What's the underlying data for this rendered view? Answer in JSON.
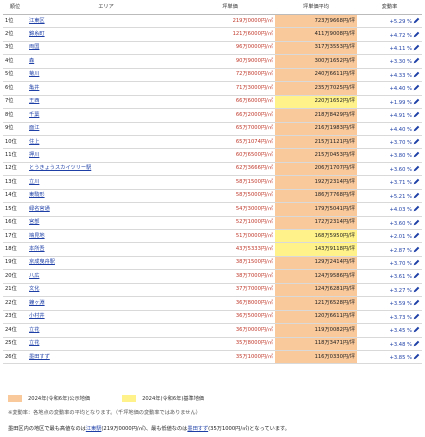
{
  "headers": {
    "rank": "順位",
    "area": "エリア",
    "land": "坪単価",
    "tsubo": "坪単価平均",
    "rate": "変動率"
  },
  "rows": [
    {
      "rank": "1位",
      "area": "江東区",
      "land": "219万0000円/㎡",
      "tsubo": "723万9668円/坪",
      "rate": "+5.29 %"
    },
    {
      "rank": "2位",
      "area": "錦糸町",
      "land": "121万6000円/㎡",
      "tsubo": "411万9008円/坪",
      "rate": "+4.72 %"
    },
    {
      "rank": "3位",
      "area": "両国",
      "land": "96万0000円/㎡",
      "tsubo": "317万3553円/坪",
      "rate": "+4.11 %"
    },
    {
      "rank": "4位",
      "area": "森",
      "land": "90万9000円/㎡",
      "tsubo": "300万1652円/坪",
      "rate": "+3.30 %"
    },
    {
      "rank": "5位",
      "area": "菊川",
      "land": "72万8000円/㎡",
      "tsubo": "240万6611円/坪",
      "rate": "+4.33 %"
    },
    {
      "rank": "6位",
      "area": "亀井",
      "land": "71万3000円/㎡",
      "tsubo": "235万7025円/坪",
      "rate": "+4.40 %"
    },
    {
      "rank": "7位",
      "area": "王西",
      "land": "66万6000円/㎡",
      "tsubo": "220万1652円/坪",
      "rate": "+1.99 %",
      "highlight": true
    },
    {
      "rank": "8位",
      "area": "千葉",
      "land": "66万2000円/㎡",
      "tsubo": "218万8429円/坪",
      "rate": "+4.91 %"
    },
    {
      "rank": "9位",
      "area": "面江",
      "land": "65万7000円/㎡",
      "tsubo": "216万1983円/坪",
      "rate": "+4.40 %"
    },
    {
      "rank": "10位",
      "area": "住上",
      "land": "65万1074円/㎡",
      "tsubo": "215万1121円/坪",
      "rate": "+3.70 %"
    },
    {
      "rank": "11位",
      "area": "押川",
      "land": "60万6500円/㎡",
      "tsubo": "215万0453円/坪",
      "rate": "+3.80 %"
    },
    {
      "rank": "12位",
      "area": "とうきょうスカイツリー駅",
      "land": "62万3666円/㎡",
      "tsubo": "206万1707円/坪",
      "rate": "+3.60 %"
    },
    {
      "rank": "13位",
      "area": "立川",
      "land": "58万1500円/㎡",
      "tsubo": "192万2314円/坪",
      "rate": "+3.71 %"
    },
    {
      "rank": "14位",
      "area": "東駒形",
      "land": "58万5000円/㎡",
      "tsubo": "186万7768円/坪",
      "rate": "+5.21 %"
    },
    {
      "rank": "15位",
      "area": "緑名宮通",
      "land": "54万3000円/㎡",
      "tsubo": "179万5041円/坪",
      "rate": "+4.03 %"
    },
    {
      "rank": "16位",
      "area": "宮部",
      "land": "52万1000円/㎡",
      "tsubo": "172万2314円/坪",
      "rate": "+3.60 %"
    },
    {
      "rank": "17位",
      "area": "鳩見地",
      "land": "51万0000円/㎡",
      "tsubo": "168万5950円/坪",
      "rate": "+2.01 %",
      "highlight": true
    },
    {
      "rank": "18位",
      "area": "本所吾",
      "land": "43万5333円/㎡",
      "tsubo": "143万9118円/坪",
      "rate": "+2.87 %",
      "highlight": true
    },
    {
      "rank": "19位",
      "area": "京成曳舟駅",
      "land": "38万1500円/㎡",
      "tsubo": "129万2414円/坪",
      "rate": "+3.70 %"
    },
    {
      "rank": "20位",
      "area": "八広",
      "land": "38万7000円/㎡",
      "tsubo": "124万9586円/坪",
      "rate": "+3.61 %"
    },
    {
      "rank": "21位",
      "area": "文化",
      "land": "37万7000円/㎡",
      "tsubo": "124万6281円/坪",
      "rate": "+3.27 %"
    },
    {
      "rank": "22位",
      "area": "鐘ヶ淵",
      "land": "36万8000円/㎡",
      "tsubo": "121万6528円/坪",
      "rate": "+3.59 %"
    },
    {
      "rank": "23位",
      "area": "小村井",
      "land": "36万5000円/㎡",
      "tsubo": "120万6611円/坪",
      "rate": "+3.73 %"
    },
    {
      "rank": "24位",
      "area": "立花",
      "land": "36万0000円/㎡",
      "tsubo": "119万0082円/坪",
      "rate": "+3.45 %"
    },
    {
      "rank": "25位",
      "area": "立花",
      "land": "35万8000円/㎡",
      "tsubo": "118万3471円/坪",
      "rate": "+3.48 %"
    },
    {
      "rank": "26位",
      "area": "墨田すず",
      "land": "35万1000円/㎡",
      "tsubo": "116万0330円/坪",
      "rate": "+3.85 %"
    }
  ],
  "legend": {
    "orange_label": "2024年(令和6年)公示地価",
    "yellow_label": "2024年(令和6年)基準地価"
  },
  "note": "※変動率：各地点の変動率の平均となります。（千坪地価の変動率ではありません）",
  "summary": {
    "prefix": "墨田区内の地区で最も高値なのは",
    "top_link": "江東駅",
    "middle": "(219万0000円/㎡)、最も低値なのは",
    "bottom_link": "墨田すず",
    "suffix": "(35万1000円/㎡)となっています。"
  },
  "colors": {
    "tsubo_bg": "#f9c89b",
    "highlight_bg": "#fff28a",
    "link": "#1d3fa6",
    "land_text": "#c0392b"
  },
  "icons": {
    "rate_trend": "pen-icon"
  }
}
